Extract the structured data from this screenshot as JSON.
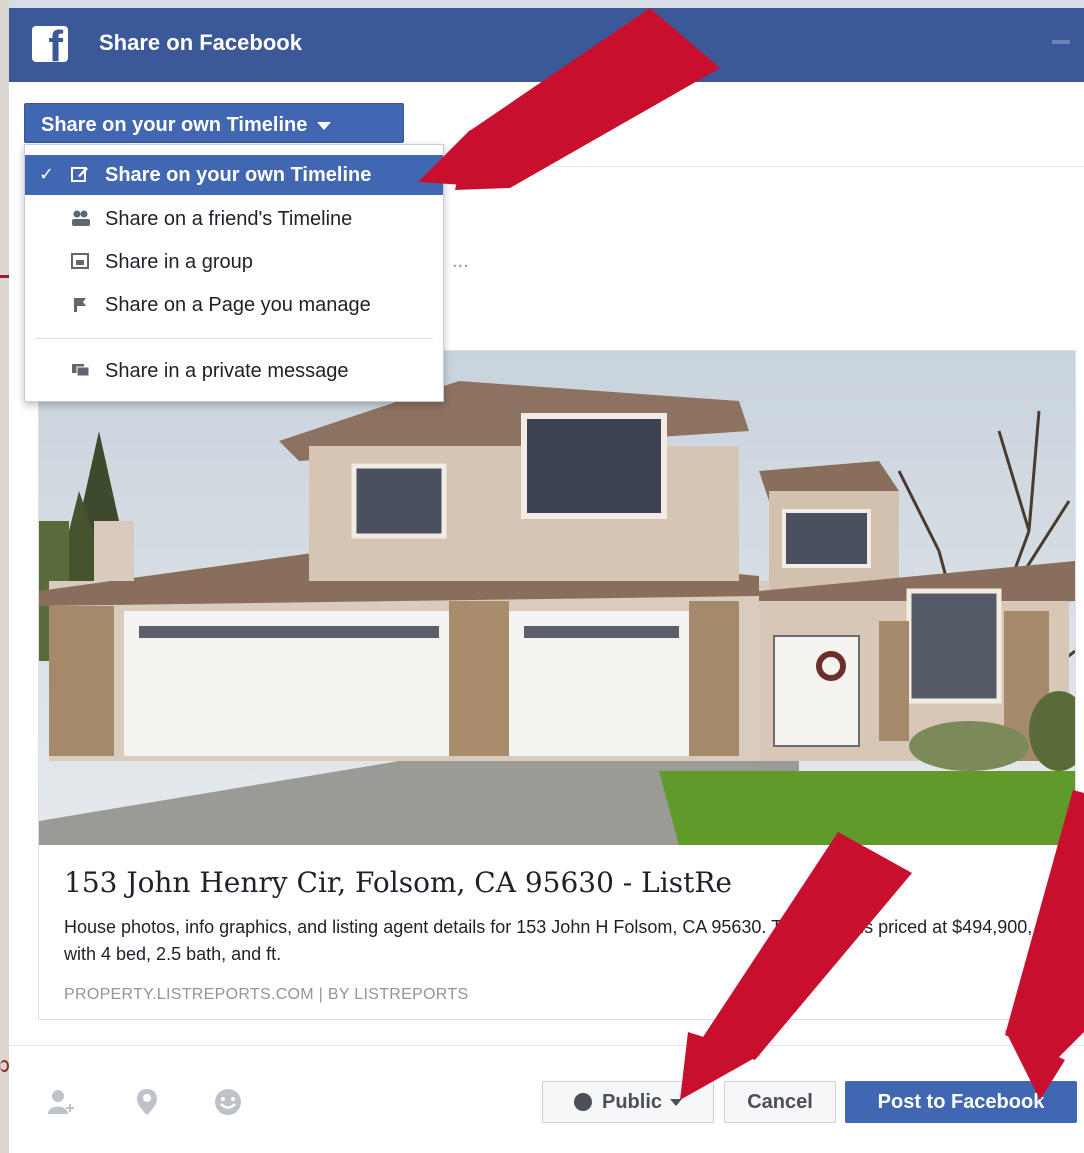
{
  "header": {
    "title": "Share on Facebook",
    "logo_letter": "f"
  },
  "audience": {
    "selected_label": "Share on your own Timeline"
  },
  "dropdown": {
    "items": [
      {
        "label": "Share on your own Timeline",
        "icon": "compose-icon",
        "selected": true
      },
      {
        "label": "Share on a friend's Timeline",
        "icon": "friends-icon",
        "selected": false
      },
      {
        "label": "Share in a group",
        "icon": "group-icon",
        "selected": false
      },
      {
        "label": "Share on a Page you manage",
        "icon": "flag-icon",
        "selected": false
      },
      {
        "label": "Share in a private message",
        "icon": "message-icon",
        "selected": false
      }
    ]
  },
  "composer": {
    "placeholder_fragment": "..."
  },
  "link_preview": {
    "title": "153 John Henry Cir, Folsom, CA 95630 - ListRe",
    "description": "House photos, info graphics, and listing agent details for 153 John H      Folsom, CA 95630. This home is priced at $494,900, with 4 bed, 2.5 bath, and          ft.",
    "domain": "PROPERTY.LISTREPORTS.COM | BY LISTREPORTS"
  },
  "footer": {
    "icons": [
      "tag-friends-icon",
      "location-pin-icon",
      "feeling-icon"
    ],
    "privacy_label": "Public",
    "cancel_label": "Cancel",
    "post_label": "Post to Facebook"
  },
  "colors": {
    "facebook_blue": "#3b5998",
    "button_blue": "#4267b2",
    "annotation_red": "#c8102e"
  }
}
